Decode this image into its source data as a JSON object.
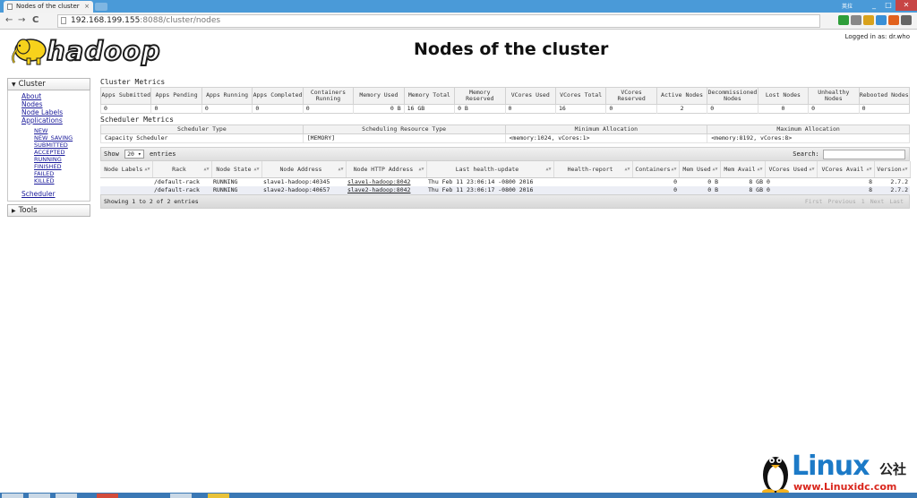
{
  "browser": {
    "tab_title": "Nodes of the cluster",
    "tab_close": "×",
    "url_host": "192.168.199.155",
    "url_rest": ":8088/cluster/nodes",
    "nav_back": "←",
    "nav_forward": "→",
    "nav_reload": "C",
    "ime": "英拉",
    "win_min": "_",
    "win_max": "□",
    "win_close": "✕"
  },
  "header": {
    "logo_text": "hadoop",
    "title": "Nodes of the cluster",
    "logged_in": "Logged in as: dr.who"
  },
  "sidebar": {
    "cluster_label": "Cluster",
    "links": [
      "About",
      "Nodes",
      "Node Labels",
      "Applications"
    ],
    "app_states": [
      "NEW",
      "NEW_SAVING",
      "SUBMITTED",
      "ACCEPTED",
      "RUNNING",
      "FINISHED",
      "FAILED",
      "KILLED"
    ],
    "scheduler_link": "Scheduler",
    "tools_label": "Tools"
  },
  "cluster_metrics": {
    "title": "Cluster Metrics",
    "headers": [
      "Apps Submitted",
      "Apps Pending",
      "Apps Running",
      "Apps Completed",
      "Containers Running",
      "Memory Used",
      "Memory Total",
      "Memory Reserved",
      "VCores Used",
      "VCores Total",
      "VCores Reserved",
      "Active Nodes",
      "Decommissioned Nodes",
      "Lost Nodes",
      "Unhealthy Nodes",
      "Rebooted Nodes"
    ],
    "values": [
      "0",
      "0",
      "0",
      "0",
      "0",
      "0 B",
      "16 GB",
      "0 B",
      "0",
      "16",
      "0",
      "2",
      "0",
      "0",
      "0",
      "0"
    ]
  },
  "scheduler_metrics": {
    "title": "Scheduler Metrics",
    "headers": [
      "Scheduler Type",
      "Scheduling Resource Type",
      "Minimum Allocation",
      "Maximum Allocation"
    ],
    "values": [
      "Capacity Scheduler",
      "[MEMORY]",
      "<memory:1024, vCores:1>",
      "<memory:8192, vCores:8>"
    ]
  },
  "nodes_table": {
    "show_label": "Show",
    "page_size": "20",
    "entries_label": "entries",
    "search_label": "Search:",
    "headers": [
      "Node Labels",
      "Rack",
      "Node State",
      "Node Address",
      "Node HTTP Address",
      "Last health-update",
      "Health-report",
      "Containers",
      "Mem Used",
      "Mem Avail",
      "VCores Used",
      "VCores Avail",
      "Version"
    ],
    "rows": [
      [
        "",
        "/default-rack",
        "RUNNING",
        "slave1-hadoop:40345",
        "slave1-hadoop:8042",
        "Thu Feb 11 23:06:14 -0800 2016",
        "",
        "0",
        "0 B",
        "8 GB",
        "0",
        "8",
        "2.7.2"
      ],
      [
        "",
        "/default-rack",
        "RUNNING",
        "slave2-hadoop:40657",
        "slave2-hadoop:8042",
        "Thu Feb 11 23:06:17 -0800 2016",
        "",
        "0",
        "0 B",
        "8 GB",
        "0",
        "8",
        "2.7.2"
      ]
    ],
    "info": "Showing 1 to 2 of 2 entries",
    "pager": [
      "First",
      "Previous",
      "1",
      "Next",
      "Last"
    ]
  },
  "watermark": {
    "brand": "Linux",
    "brand_cn": "公社",
    "url": "www.Linuxidc.com"
  },
  "colors": {
    "tabbar": "#4a9ad8",
    "link": "#1a1a9a",
    "row_even": "#eceef5",
    "watermark_blue": "#1c7ac7",
    "watermark_red": "#d9261c"
  }
}
